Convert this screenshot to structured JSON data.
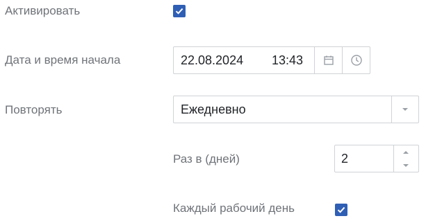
{
  "form": {
    "activate": {
      "label": "Активировать",
      "checked": true
    },
    "start": {
      "label": "Дата и время начала",
      "date": "22.08.2024",
      "time": "13:43",
      "calendar_icon": "calendar-icon",
      "clock_icon": "clock-icon"
    },
    "repeat": {
      "label": "Повторять",
      "value": "Ежедневно",
      "dropdown_icon": "chevron-down-icon"
    },
    "interval": {
      "label": "Раз в (дней)",
      "value": "2"
    },
    "workdays": {
      "label": "Каждый рабочий день",
      "checked": true
    }
  },
  "colors": {
    "accent": "#2f5fb5",
    "border": "#cfd2d6",
    "label": "#6f7378",
    "text": "#1f2226",
    "icon": "#9aa0a6"
  }
}
